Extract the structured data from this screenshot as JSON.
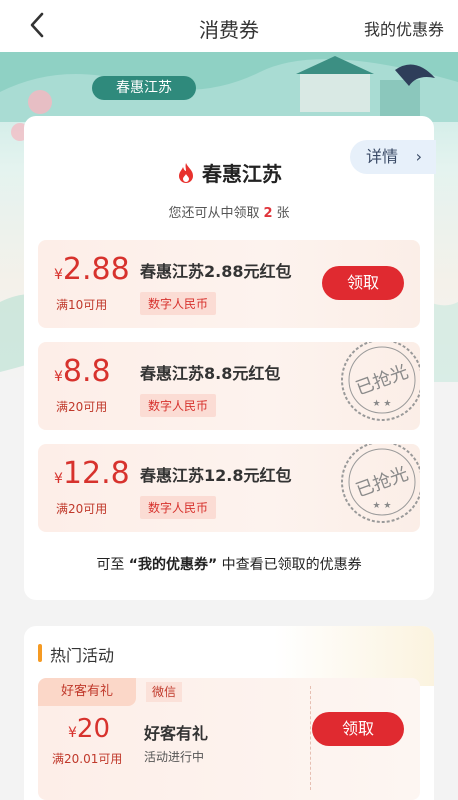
{
  "header": {
    "title": "消费券",
    "right_link": "我的优惠券"
  },
  "banner": {
    "tag": "春惠江苏"
  },
  "card": {
    "detail_label": "详情",
    "brand": "春惠江苏",
    "remaining_prefix": "您还可从中领取",
    "remaining_count": "2",
    "remaining_suffix": "张",
    "coupons": [
      {
        "amount": "2.88",
        "condition": "满10可用",
        "name": "春惠江苏2.88元红包",
        "tag": "数字人民币",
        "action": "领取"
      },
      {
        "amount": "8.8",
        "condition": "满20可用",
        "name": "春惠江苏8.8元红包",
        "tag": "数字人民币",
        "stamp": "已抢光"
      },
      {
        "amount": "12.8",
        "condition": "满20可用",
        "name": "春惠江苏12.8元红包",
        "tag": "数字人民币",
        "stamp": "已抢光"
      }
    ],
    "footnote_pre": "可至",
    "footnote_link": "“我的优惠券”",
    "footnote_post": "中查看已领取的优惠券"
  },
  "hot": {
    "title": "热门活动",
    "activity": {
      "tag": "好客有礼",
      "channel": "微信",
      "amount": "20",
      "condition": "满20.01可用",
      "name": "好客有礼",
      "status": "活动进行中",
      "action": "领取"
    }
  },
  "currency": "¥",
  "colors": {
    "accent_red": "#e02a30",
    "price_red": "#d7322d",
    "section_bar": "#f59a23"
  }
}
